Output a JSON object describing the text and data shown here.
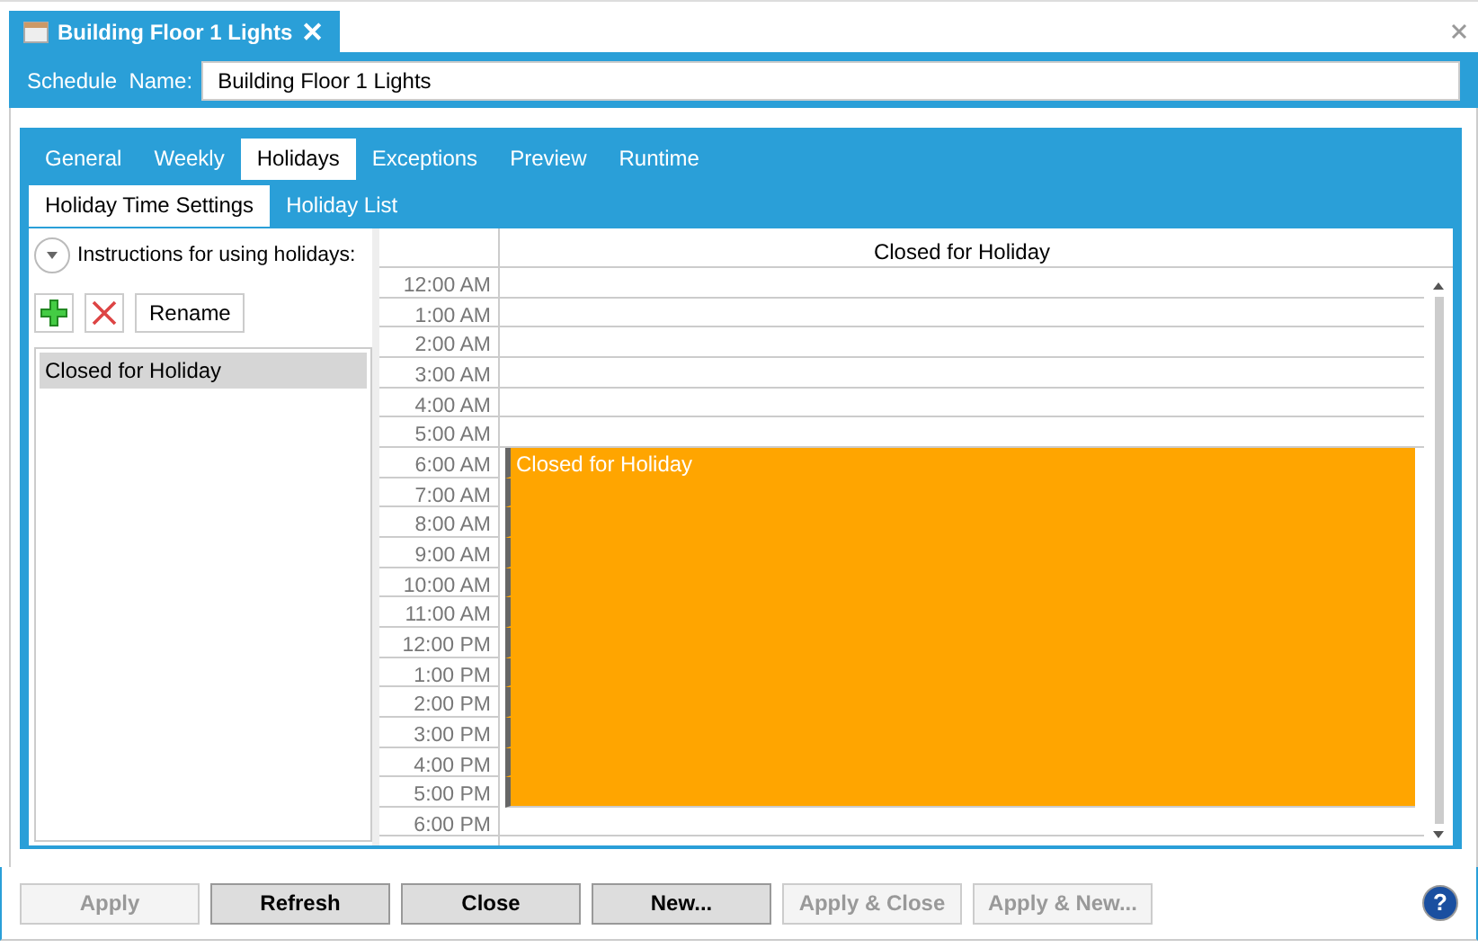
{
  "document_tab": {
    "title": "Building Floor 1 Lights",
    "close": "✕"
  },
  "schedule_name": {
    "label": "Schedule  Name:",
    "value": "Building Floor 1 Lights"
  },
  "tabs": [
    {
      "label": "General",
      "selected": false
    },
    {
      "label": "Weekly",
      "selected": false
    },
    {
      "label": "Holidays",
      "selected": true
    },
    {
      "label": "Exceptions",
      "selected": false
    },
    {
      "label": "Preview",
      "selected": false
    },
    {
      "label": "Runtime",
      "selected": false
    }
  ],
  "subtabs": [
    {
      "label": "Holiday Time Settings",
      "selected": true
    },
    {
      "label": "Holiday List",
      "selected": false
    }
  ],
  "instructions": {
    "label": "Instructions for using holidays:",
    "expanded": false
  },
  "toolbar": {
    "rename": "Rename"
  },
  "holidays": [
    {
      "name": "Closed for Holiday",
      "selected": true
    }
  ],
  "calendar": {
    "column": "Closed for Holiday",
    "event": "Closed for Holiday",
    "slots": [
      {
        "time": "12:00 AM",
        "booked": false
      },
      {
        "time": "1:00 AM",
        "booked": false
      },
      {
        "time": "2:00 AM",
        "booked": false
      },
      {
        "time": "3:00 AM",
        "booked": false
      },
      {
        "time": "4:00 AM",
        "booked": false
      },
      {
        "time": "5:00 AM",
        "booked": false
      },
      {
        "time": "6:00 AM",
        "booked": true
      },
      {
        "time": "7:00 AM",
        "booked": true
      },
      {
        "time": "8:00 AM",
        "booked": true
      },
      {
        "time": "9:00 AM",
        "booked": true
      },
      {
        "time": "10:00 AM",
        "booked": true
      },
      {
        "time": "11:00 AM",
        "booked": true
      },
      {
        "time": "12:00 PM",
        "booked": true
      },
      {
        "time": "1:00 PM",
        "booked": true
      },
      {
        "time": "2:00 PM",
        "booked": true
      },
      {
        "time": "3:00 PM",
        "booked": true
      },
      {
        "time": "4:00 PM",
        "booked": true
      },
      {
        "time": "5:00 PM",
        "booked": true
      },
      {
        "time": "6:00 PM",
        "booked": false
      }
    ]
  },
  "buttons": [
    {
      "label": "Apply",
      "disabled": true
    },
    {
      "label": "Refresh",
      "disabled": false
    },
    {
      "label": "Close",
      "disabled": false
    },
    {
      "label": "New...",
      "disabled": false
    },
    {
      "label": "Apply & Close",
      "disabled": true
    },
    {
      "label": "Apply & New...",
      "disabled": true
    }
  ],
  "help": "?"
}
